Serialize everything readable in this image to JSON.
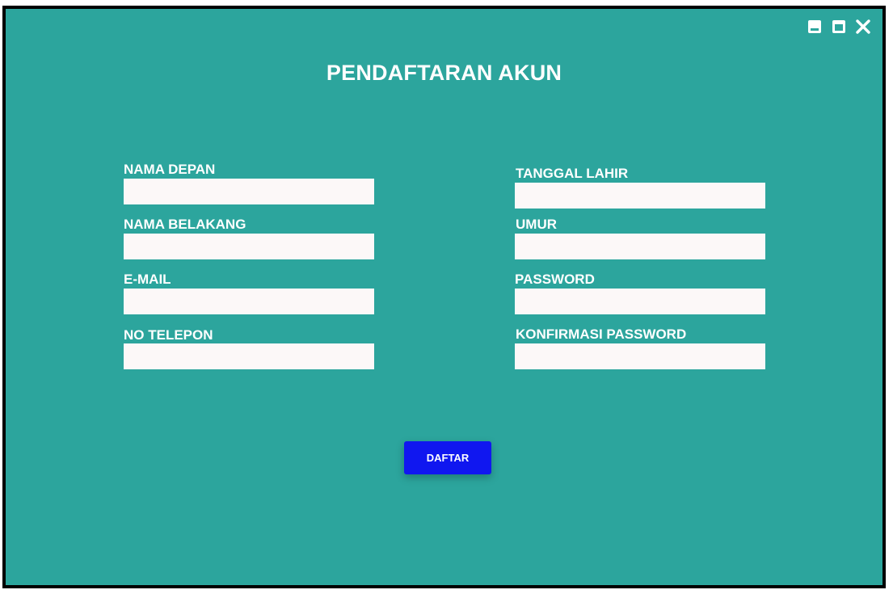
{
  "window": {
    "title": "PENDAFTARAN AKUN",
    "controls": [
      "minimize-icon",
      "maximize-icon",
      "close-icon"
    ]
  },
  "form": {
    "left": [
      {
        "label": "NAMA DEPAN",
        "value": ""
      },
      {
        "label": "NAMA BELAKANG",
        "value": ""
      },
      {
        "label": "E-MAIL",
        "value": ""
      },
      {
        "label": "NO TELEPON",
        "value": ""
      }
    ],
    "right": [
      {
        "label": "TANGGAL LAHIR",
        "value": ""
      },
      {
        "label": "UMUR",
        "value": ""
      },
      {
        "label": "PASSWORD",
        "value": ""
      },
      {
        "label": "KONFIRMASI PASSWORD",
        "value": ""
      }
    ],
    "submit_label": "DAFTAR"
  },
  "colors": {
    "background": "#2ca59d",
    "input": "#fcf8f8",
    "button": "#1017f0",
    "text": "#ffffff"
  }
}
